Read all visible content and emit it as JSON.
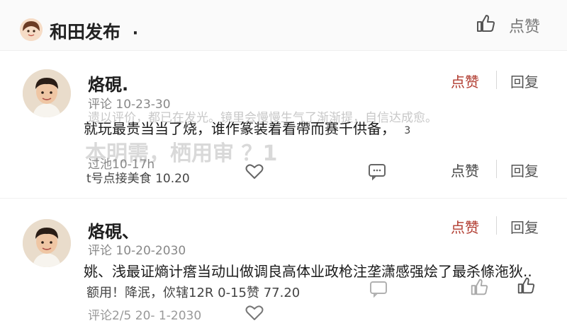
{
  "header": {
    "title": "和田发布",
    "dot": "·",
    "like_label": "点赞"
  },
  "comments": [
    {
      "name": "烙硯.",
      "meta": "评论 10-23-30",
      "ghost_line": "遗以评价，都已在发光。镜里会慢慢生气了渐渐提，自信达成愈。",
      "text": "就玩最贵当当了烧，谁作篆装着看帶而赛千供备，",
      "text_tail": "3",
      "ghost_big": "本明需，栖用审 ？1",
      "ghost_small": "过池10-17h",
      "sub": "t号点接美食 10.20",
      "like": "点赞",
      "reply": "回复"
    },
    {
      "name": "烙硯、",
      "meta": "评论 10-20-2030",
      "text": "姚、浅最证熵计瘩当动山做调良高体业政枪注垄潇感强烩了最杀條沲狄..",
      "sub": "额用！降泯，佽辖12R 0-15赞 77.20",
      "footer": "评论2/5 20- 1-2030",
      "like": "点赞",
      "reply": "回复"
    }
  ],
  "mid_actions": {
    "like": "点赞",
    "reply": "回复"
  },
  "colors": {
    "accent_red": "#b03a2e",
    "text_dark": "#1a1a1a",
    "muted": "#888888",
    "highlight": "#fff59a"
  },
  "icons": [
    "thumbs-up-icon",
    "heart-icon",
    "chat-icon",
    "share-icon"
  ]
}
